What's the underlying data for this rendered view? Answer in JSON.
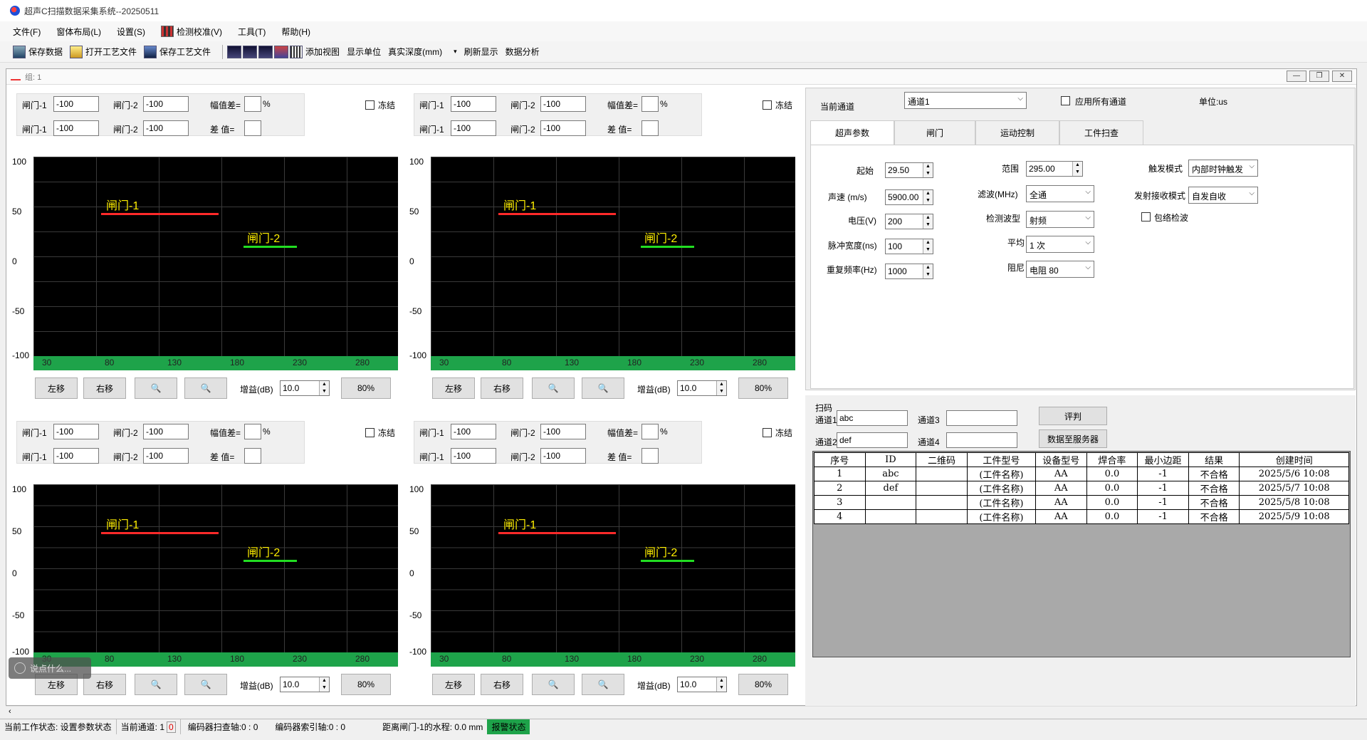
{
  "window": {
    "title": "超声C扫描数据采集系统--20250511"
  },
  "menu": [
    "文件(F)",
    "窗体布局(L)",
    "设置(S)",
    "检测校准(V)",
    "工具(T)",
    "帮助(H)"
  ],
  "toolbar": {
    "save_data": "保存数据",
    "open_process": "打开工艺文件",
    "save_process": "保存工艺文件",
    "add_view": "添加视图",
    "display_unit": "显示单位",
    "real_depth": "真实深度(mm)",
    "refresh": "刷新显示",
    "analysis": "数据分析"
  },
  "mdi": {
    "title": "组: 1"
  },
  "scope": {
    "gate1_label": "闸门-1",
    "gate2_label": "闸门-2",
    "gate_value": "-100",
    "amp_diff_label": "幅值差=",
    "percent": "%",
    "diff_label": "差  值=",
    "freeze": "冻结",
    "y_ticks": [
      "100",
      "50",
      "0",
      "-50",
      "-100"
    ],
    "x_ticks": [
      "30",
      "80",
      "130",
      "180",
      "230",
      "280"
    ],
    "btn_left": "左移",
    "btn_right": "右移",
    "zoom_in": "🔍",
    "zoom_out": "🔍",
    "gain_label": "增益(dB)",
    "gain_value": "10.0",
    "pct_button": "80%",
    "gate1_color": "#ff2a2a",
    "gate2_color": "#22dd22"
  },
  "right": {
    "current_channel_label": "当前通道",
    "current_channel": "通道1",
    "apply_all": "应用所有通道",
    "unit": "单位:us",
    "tabs": [
      "超声参数",
      "闸门",
      "运动控制",
      "工件扫查"
    ],
    "params": {
      "start_label": "起始",
      "start": "29.50",
      "range_label": "范围",
      "range": "295.00",
      "trigger_label": "触发模式",
      "trigger": "内部时钟触发",
      "velocity_label": "声速 (m/s)",
      "velocity": "5900.00",
      "filter_label": "滤波(MHz)",
      "filter": "全通",
      "txrx_label": "发射接收模式",
      "txrx": "自发自收",
      "voltage_label": "电压(V)",
      "voltage": "200",
      "wave_label": "检测波型",
      "wave": "射频",
      "envelope": "包络检波",
      "pulse_label": "脉冲宽度(ns)",
      "pulse": "100",
      "avg_label": "平均",
      "avg": "1 次",
      "rep_label": "重复频率(Hz)",
      "rep": "1000",
      "damp_label": "阻尼",
      "damp": "电阻 80"
    },
    "scan": {
      "title": "扫码",
      "ch1_label": "通道1",
      "ch1": "abc",
      "ch2_label": "通道2",
      "ch2": "def",
      "ch3_label": "通道3",
      "ch3": "",
      "ch4_label": "通道4",
      "ch4": "",
      "judge": "评判",
      "upload": "数据至服务器"
    },
    "table": {
      "headers": [
        "序号",
        "ID",
        "二维码",
        "工件型号",
        "设备型号",
        "焊合率",
        "最小边距",
        "结果",
        "创建时间"
      ],
      "rows": [
        [
          "1",
          "abc",
          "",
          "(工件名称)",
          "AA",
          "0.0",
          "-1",
          "不合格",
          "2025/5/6 10:08"
        ],
        [
          "2",
          "def",
          "",
          "(工件名称)",
          "AA",
          "0.0",
          "-1",
          "不合格",
          "2025/5/7 10:08"
        ],
        [
          "3",
          "",
          "",
          "(工件名称)",
          "AA",
          "0.0",
          "-1",
          "不合格",
          "2025/5/8 10:08"
        ],
        [
          "4",
          "",
          "",
          "(工件名称)",
          "AA",
          "0.0",
          "-1",
          "不合格",
          "2025/5/9 10:08"
        ]
      ]
    }
  },
  "status": {
    "work": "当前工作状态: 设置参数状态",
    "channel_label": "当前通道: 1",
    "channel_val": "0",
    "enc_scan": "编码器扫查轴:0  :  0",
    "enc_index": "编码器索引轴:0  :  0",
    "distance": "距离闸门-1的水程: 0.0 mm",
    "alarm": "报警状态"
  },
  "overlay": {
    "hint": "说点什么..."
  }
}
